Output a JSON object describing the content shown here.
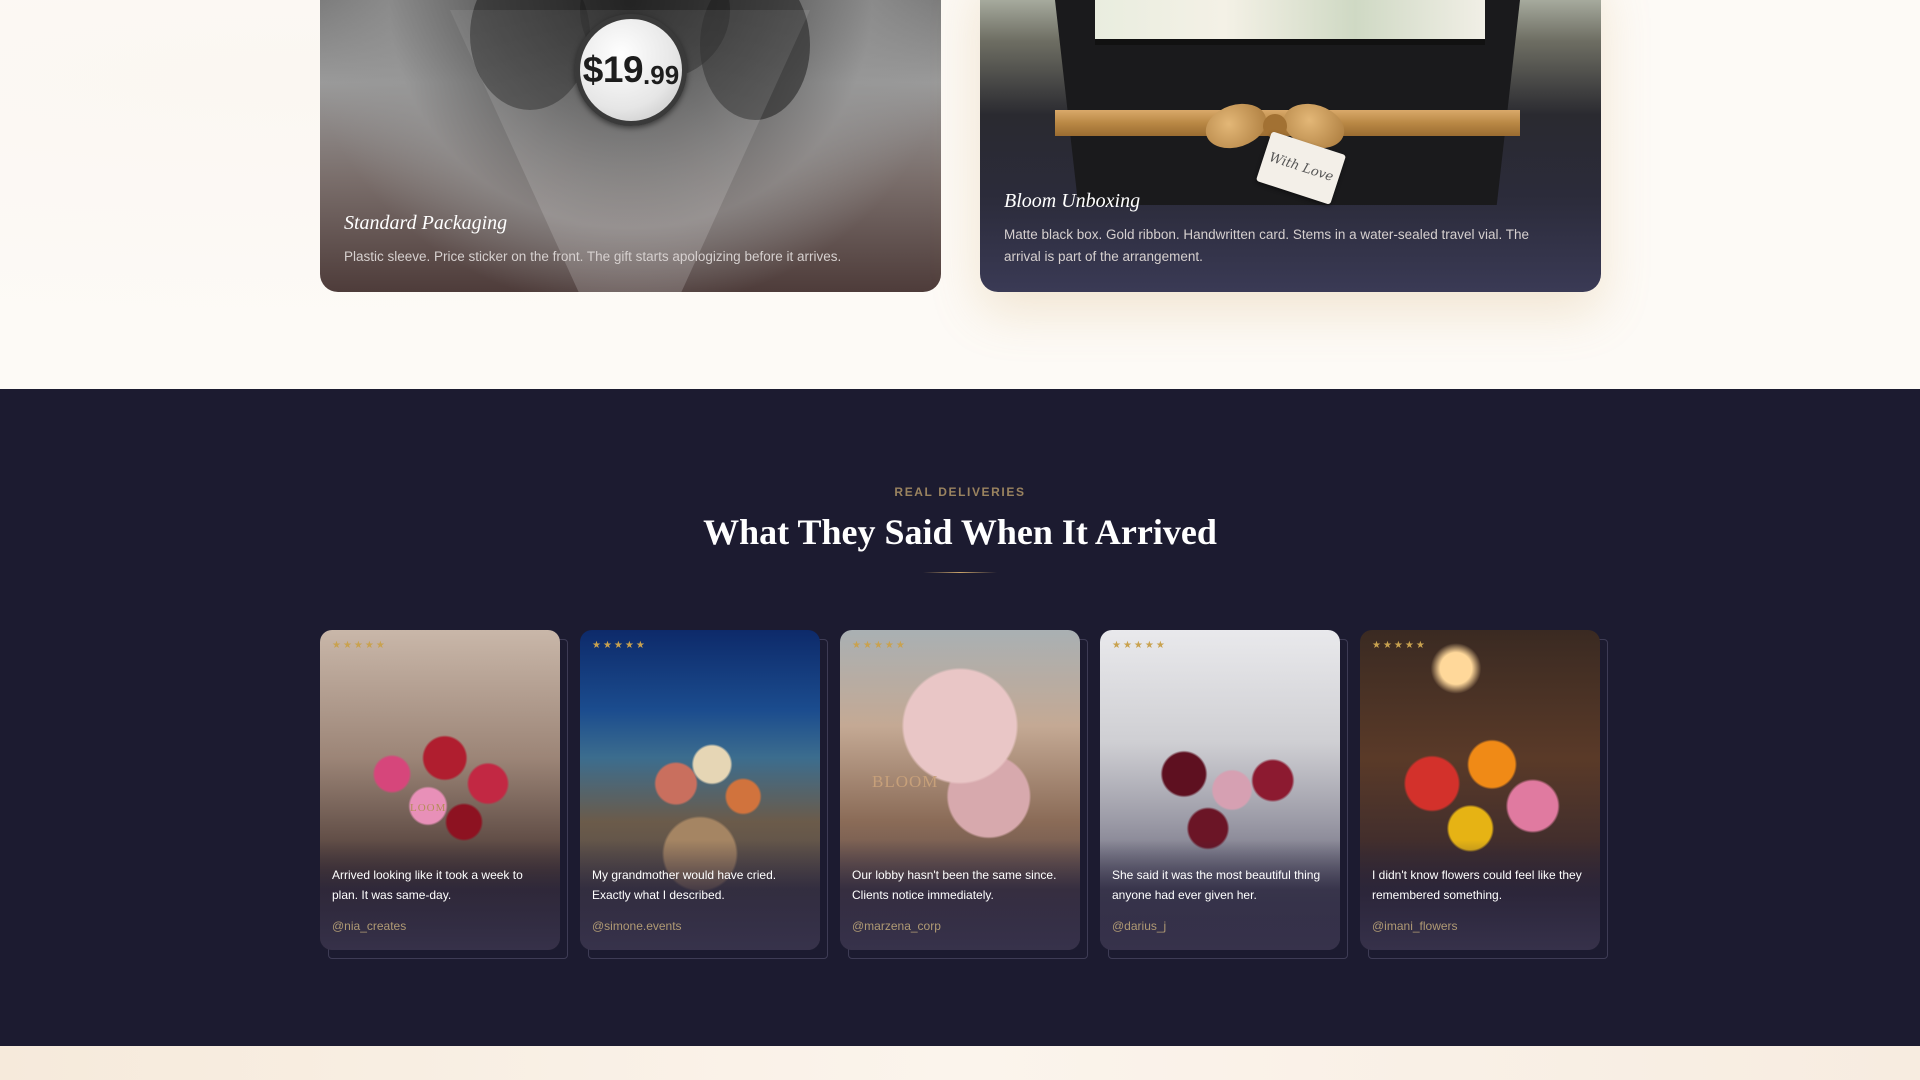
{
  "packaging": {
    "standard": {
      "title": "Standard Packaging",
      "description": "Plastic sleeve. Price sticker on the front. The gift starts apologizing before it arrives.",
      "price_main": "$19",
      "price_cents": ".99"
    },
    "bloom": {
      "title": "Bloom Unboxing",
      "description_line1": "Matte black box. Gold ribbon. Handwritten card. Stems in a water-sealed travel vial. The",
      "description_line2": "arrival is part of the arrangement.",
      "tag_text": "With Love"
    }
  },
  "reviews": {
    "eyebrow": "REAL DELIVERIES",
    "heading": "What They Said When It Arrived",
    "items": [
      {
        "stars": "★★★★★",
        "quote": "Arrived looking like it took a week to plan. It was same-day.",
        "handle": "@nia_creates",
        "photo_label": "LOOM"
      },
      {
        "stars": "★★★★★",
        "quote": "My grandmother would have cried. Exactly what I described.",
        "handle": "@simone.events"
      },
      {
        "stars": "★★★★★",
        "quote": "Our lobby hasn't been the same since. Clients notice immediately.",
        "handle": "@marzena_corp",
        "photo_label": "BLOOM"
      },
      {
        "stars": "★★★★★",
        "quote": "She said it was the most beautiful thing anyone had ever given her.",
        "handle": "@darius_j"
      },
      {
        "stars": "★★★★★",
        "quote": "I didn't know flowers could feel like they remembered something.",
        "handle": "@imani_flowers"
      }
    ]
  },
  "colors": {
    "reviews_bg": "#1c1b30",
    "accent_gold": "#c9a36a",
    "star_gold": "#c9a24f"
  }
}
